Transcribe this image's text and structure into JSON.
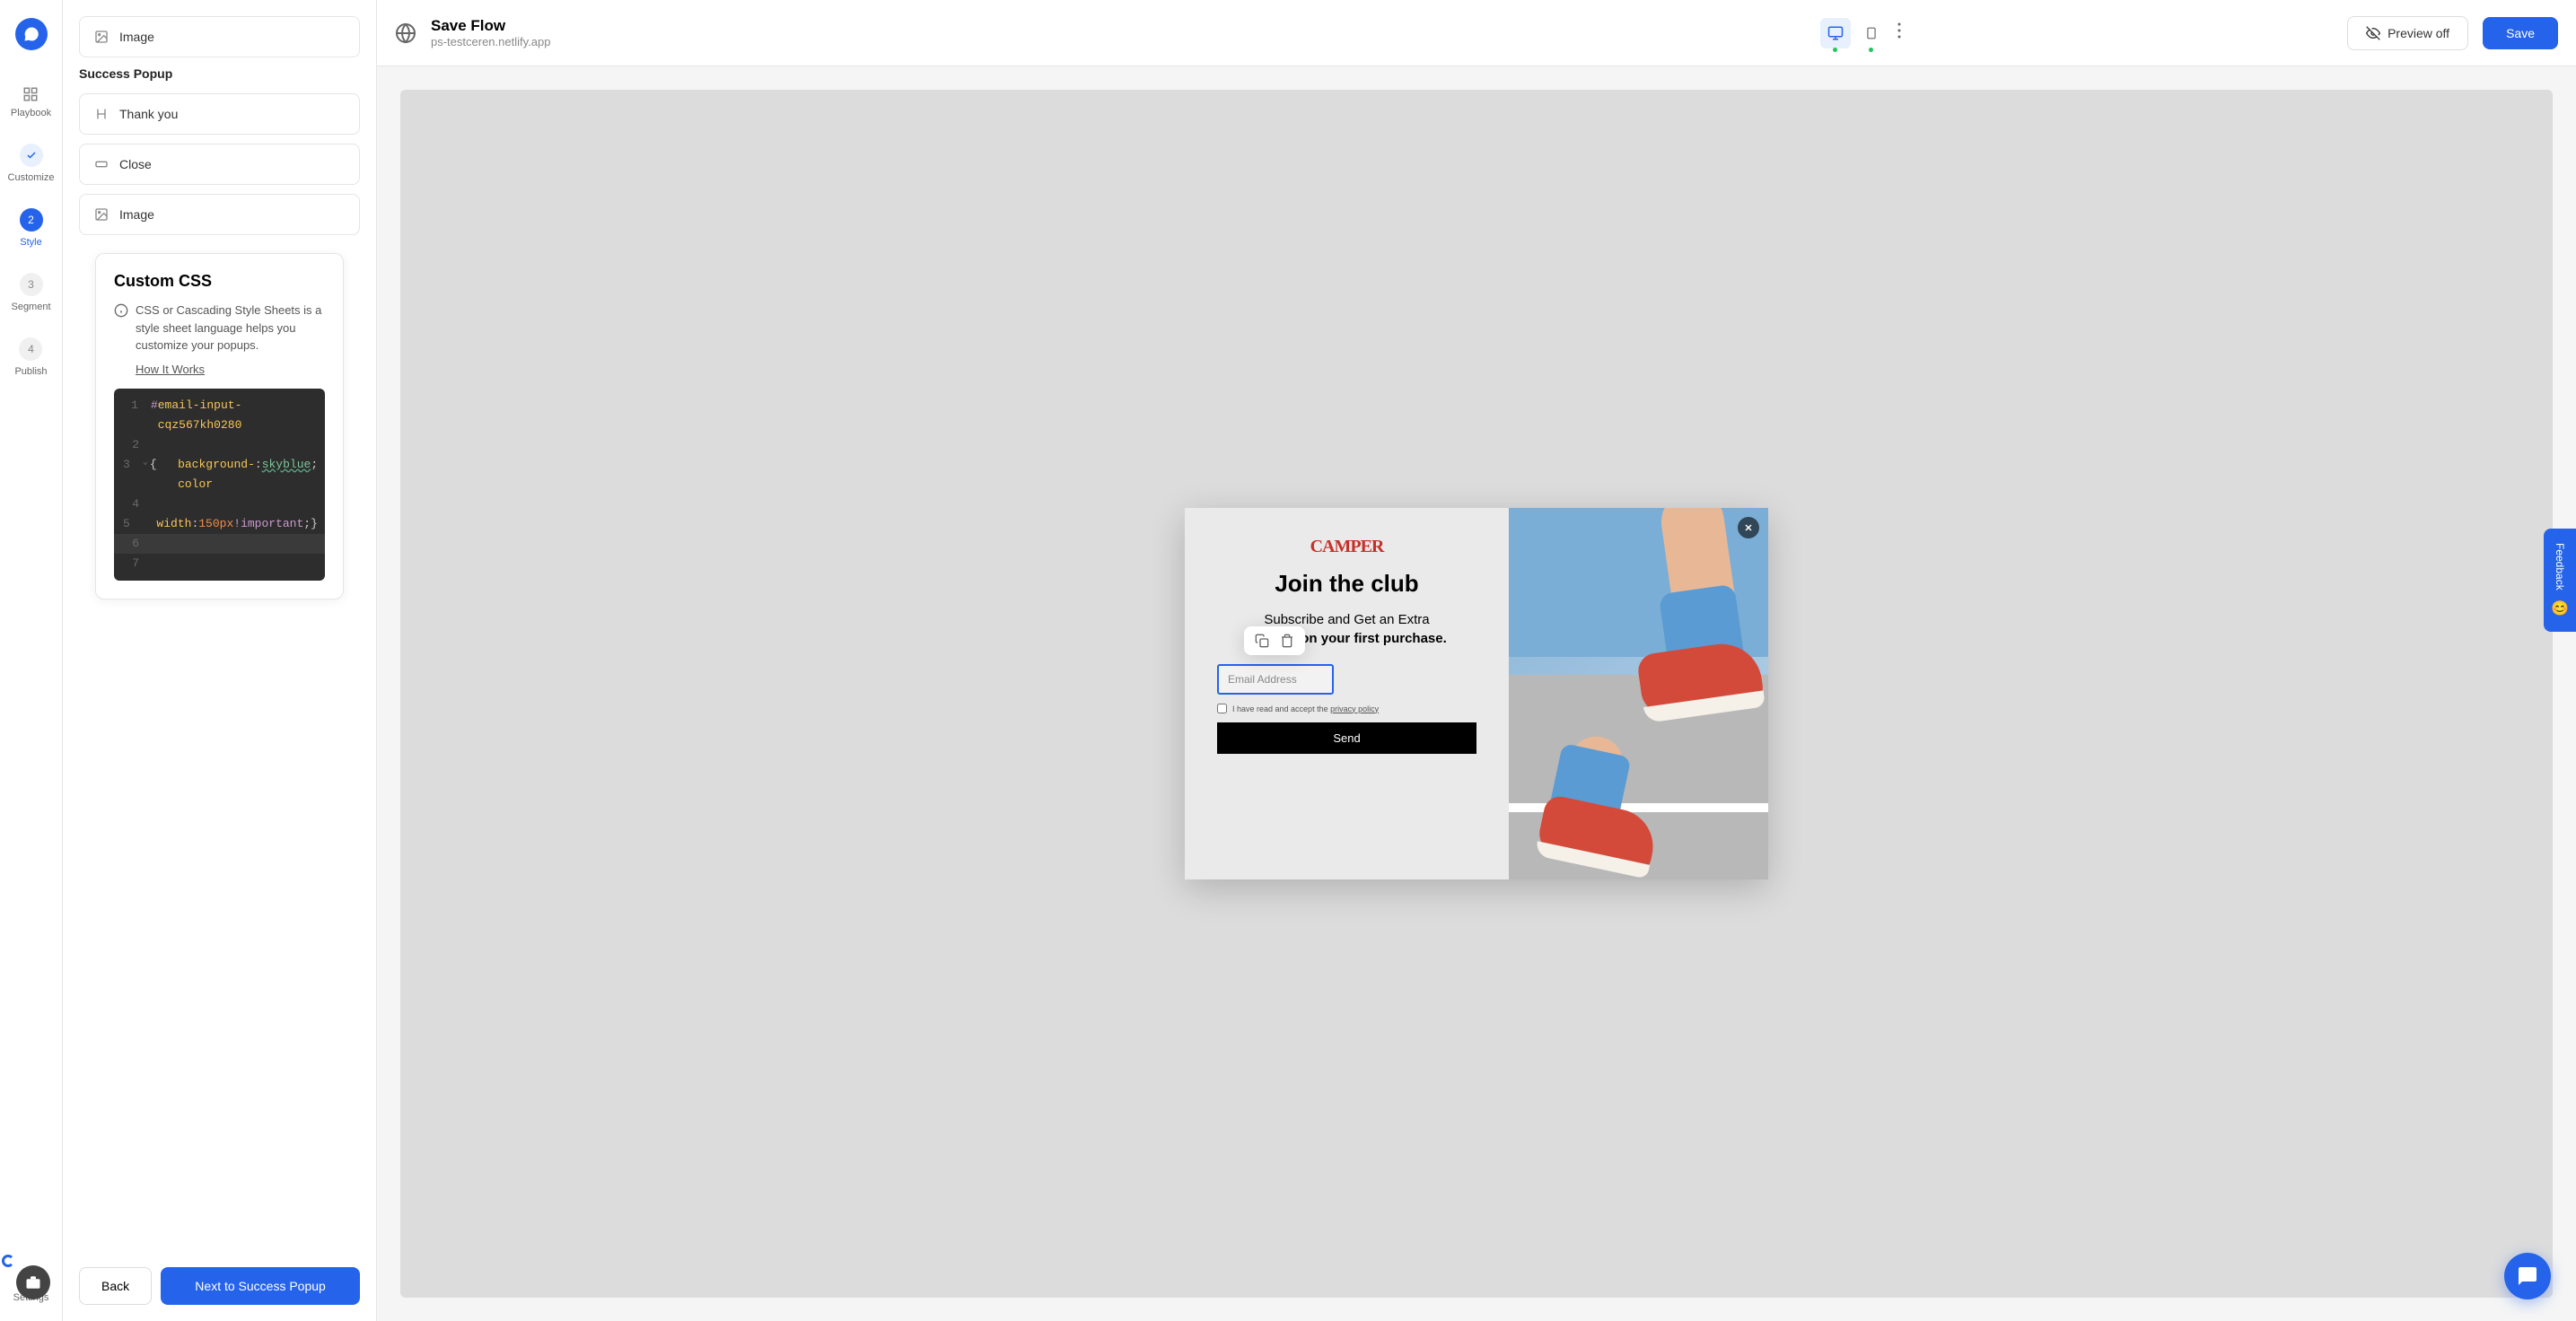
{
  "header": {
    "title": "Save Flow",
    "subtitle": "ps-testceren.netlify.app",
    "preview_label": "Preview off",
    "save_label": "Save"
  },
  "rail": {
    "items": [
      {
        "label": "Playbook",
        "step": ""
      },
      {
        "label": "Customize",
        "step": "✓"
      },
      {
        "label": "Style",
        "step": "2"
      },
      {
        "label": "Segment",
        "step": "3"
      },
      {
        "label": "Publish",
        "step": "4"
      }
    ],
    "settings_label": "Settings"
  },
  "panel": {
    "items_top": [
      {
        "label": "Image"
      }
    ],
    "section_title": "Success Popup",
    "items_success": [
      {
        "label": "Thank you",
        "icon": "heading"
      },
      {
        "label": "Close",
        "icon": "button"
      },
      {
        "label": "Image",
        "icon": "image"
      }
    ],
    "css": {
      "title": "Custom CSS",
      "description": "CSS or Cascading Style Sheets is a style sheet language helps you customize your popups.",
      "link": "How It Works",
      "code": {
        "line1_selector": "email-input-cqz567kh0280",
        "line3_prop": "background-color",
        "line3_val": "skyblue",
        "line5_prop": "width",
        "line5_num": "150",
        "line5_unit": "px",
        "line5_important": "!important"
      }
    },
    "back_label": "Back",
    "next_label": "Next to Success Popup"
  },
  "popup": {
    "brand": "CAMPER",
    "title": "Join the club",
    "subtitle_part1": "Subscribe and Get an Extra",
    "subtitle_part2": "25% Off on your first purchase.",
    "email_placeholder": "Email Address",
    "consent_text": "I have read and accept the ",
    "consent_link": "privacy policy",
    "send_label": "Send"
  },
  "feedback_label": "Feedback"
}
